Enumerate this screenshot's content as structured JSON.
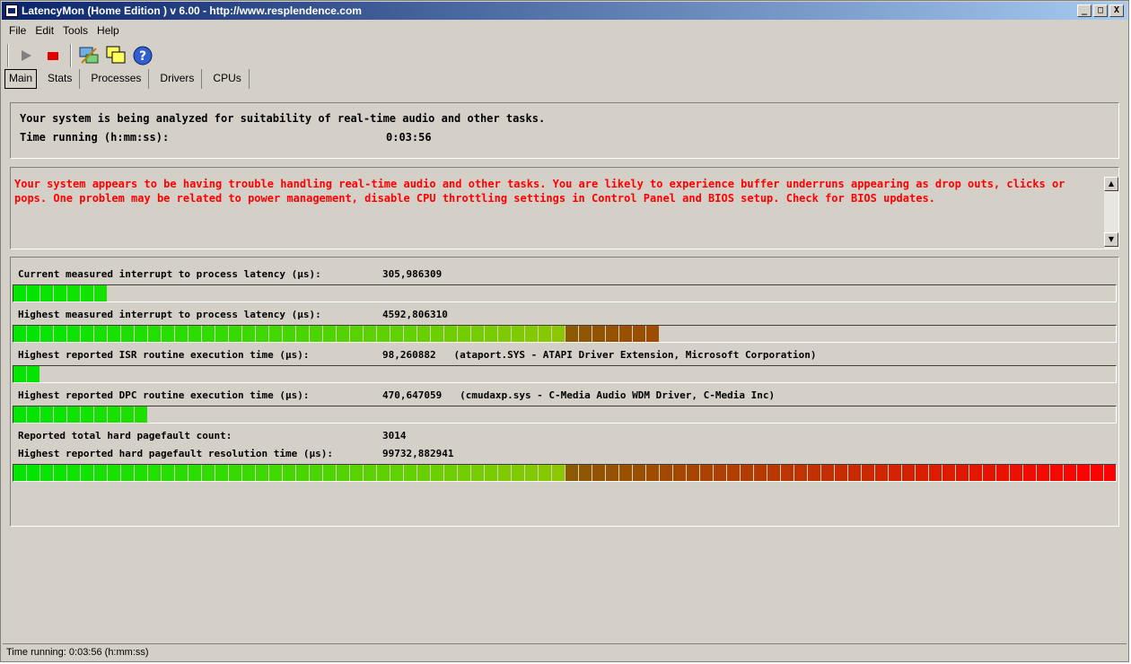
{
  "window": {
    "title": "LatencyMon  (Home Edition )  v 6.00 - http://www.resplendence.com",
    "minimize": "_",
    "maximize": "□",
    "close": "X"
  },
  "menu": [
    "File",
    "Edit",
    "Tools",
    "Help"
  ],
  "toolbar": {
    "icons": [
      "play-icon",
      "stop-icon",
      "network-icon",
      "windows-icon",
      "help-icon"
    ],
    "help_glyph": "?"
  },
  "tabs": [
    "Main",
    "Stats",
    "Processes",
    "Drivers",
    "CPUs"
  ],
  "active_tab": "Main",
  "status_panel": {
    "line1": "Your system is being analyzed for suitability of real-time audio and other tasks.",
    "time_label": "Time running (h:mm:ss):",
    "time_value": "0:03:56"
  },
  "warning": {
    "text": "Your system appears to be having trouble handling real-time audio and other tasks. You are likely to experience buffer underruns appearing as drop outs, clicks or pops. One problem may be related to power management, disable CPU throttling settings in Control Panel and BIOS setup. Check for BIOS updates.",
    "color": "#ff0000"
  },
  "meters": {
    "current_latency": {
      "label": "Current measured interrupt to process latency (µs):",
      "value": "305,986309",
      "fill_segments": 7
    },
    "highest_latency": {
      "label": "Highest measured interrupt to process latency (µs):",
      "value": "4592,806310",
      "fill_segments": 48
    },
    "isr": {
      "label": "Highest reported ISR routine execution time (µs):",
      "value": "98,260882   (ataport.SYS - ATAPI Driver Extension, Microsoft Corporation)",
      "fill_segments": 2
    },
    "dpc": {
      "label": "Highest reported DPC routine execution time (µs):",
      "value": "470,647059   (cmudaxp.sys - C-Media Audio WDM Driver, C-Media Inc)",
      "fill_segments": 10
    },
    "pagefault_count": {
      "label": "Reported total hard pagefault count:",
      "value": "3014"
    },
    "pagefault_time": {
      "label": "Highest reported hard pagefault resolution time (µs):",
      "value": "99732,882941",
      "fill_segments": 82
    }
  },
  "meter_total_segments": 82,
  "status_bar": "Time running: 0:03:56  (h:mm:ss)"
}
